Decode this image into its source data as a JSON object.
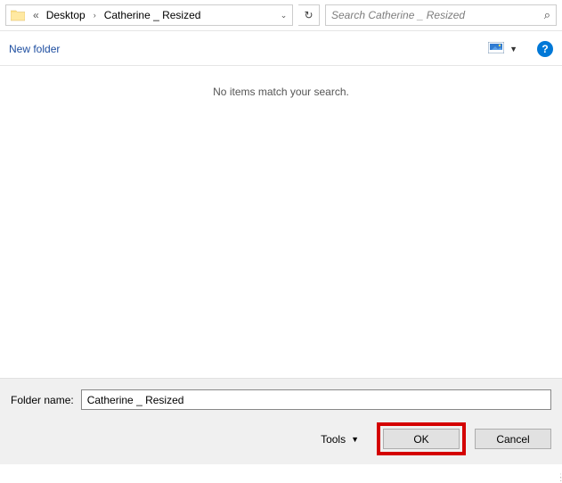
{
  "address": {
    "parent": "Desktop",
    "current": "Catherine _ Resized"
  },
  "search": {
    "placeholder": "Search Catherine _ Resized"
  },
  "toolbar": {
    "new_folder": "New folder",
    "help": "?"
  },
  "content": {
    "empty": "No items match your search."
  },
  "footer": {
    "label": "Folder name:",
    "value": "Catherine _ Resized",
    "tools": "Tools",
    "ok": "OK",
    "cancel": "Cancel"
  }
}
